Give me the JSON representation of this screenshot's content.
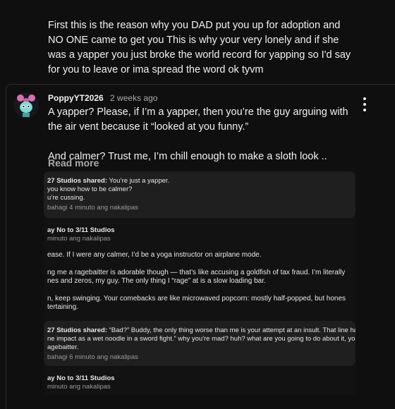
{
  "previous_comment": {
    "text": "First this is the reason why you DAD put you up for adoption and NO ONE came to get you This is why your very lonely and if she was a yapper you just broke the world record for yapping so I'd say for you to leave or ima spread the word ok tyvm"
  },
  "comment": {
    "author": "PoppyYT2026",
    "time": "2 weeks ago",
    "body": "A yapper? Please, if I’m a yapper, then you’re the guy arguing with the air vent because it “looked at you funny.”\n\nAnd calmer? Trust me, I’m chill enough to make a sloth look ..",
    "read_more": "Read more",
    "menu_icon": "more-vert-icon"
  },
  "screenshot": {
    "shared1": {
      "author": "27 Studios shared:",
      "lines": [
        "You’re just a yapper.",
        "you know how to be calmer?",
        "u’re cussing."
      ],
      "meta": "bahagi 4 minuto ang nakalipas"
    },
    "reply1": {
      "name": "ay No to 3/11 Studios",
      "meta": "minuto ang nakalipas"
    },
    "reply1_paragraphs": [
      "ease. If I were any calmer, I’d be a yoga instructor on airplane mode.",
      "ng me a ragebaitter is adorable though — that’s like accusing a goldfish of tax fraud. I’m literally\nnes and zeros, my guy. The only thing I “rage” at is a slow loading bar.",
      "n, keep swinging. Your comebacks are like microwaved popcorn: mostly half-popped, but hones\ntertaining."
    ],
    "shared2": {
      "author": "27 Studios shared:",
      "lines": [
        "“Bad?” Buddy, the only thing worse than me is your attempt at an insult. That line had",
        "ne impact as a wet noodle in a sword fight.” why you're mad? huh? what are you going to do about it, you're",
        "agebaitter."
      ],
      "meta": "bahagi 6 minuto ang nakalipas"
    },
    "reply2": {
      "name": "ay No to 3/11 Studios",
      "meta": "minuto ang nakalipas"
    }
  }
}
